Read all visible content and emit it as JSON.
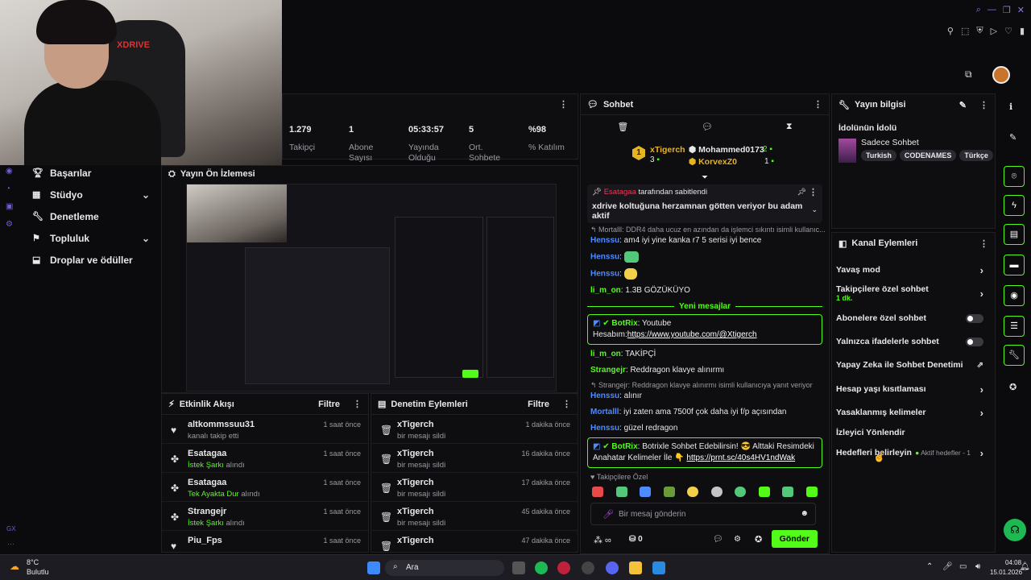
{
  "stats": [
    {
      "value": "1.279",
      "label": "Takipçi"
    },
    {
      "value": "1",
      "label": "Abone Sayısı"
    },
    {
      "value": "05:33:57",
      "label": "Yayında Olduğu"
    },
    {
      "value": "5",
      "label": "Ort. Sohbete"
    },
    {
      "value": "%98",
      "label": "% Katılım"
    }
  ],
  "cam": {
    "logo": "XDRIVE"
  },
  "nav": [
    {
      "label": "Başarılar",
      "icon": "trophy-icon"
    },
    {
      "label": "Stüdyo",
      "icon": "studio-icon",
      "chevron": "⌄"
    },
    {
      "label": "Denetleme",
      "icon": "wrench-icon"
    },
    {
      "label": "Topluluk",
      "icon": "community-icon",
      "chevron": "⌄"
    },
    {
      "label": "Droplar ve ödüller",
      "icon": "drops-icon"
    }
  ],
  "nav_badge": "GX",
  "preview": {
    "title": "Yayın Ön İzlemesi"
  },
  "activity": {
    "title": "Etkinlik Akışı",
    "filter": "Filtre",
    "items": [
      {
        "name": "altkommssuu31",
        "sub": "kanalı takip etti",
        "time": "1 saat önce",
        "icon": "heart-icon"
      },
      {
        "name": "Esatagaa",
        "sub_green": "İstek Şarkı",
        "sub": " alındı",
        "time": "1 saat önce",
        "icon": "reward-icon"
      },
      {
        "name": "Esatagaa",
        "sub_green": "Tek Ayakta Dur",
        "sub": " alındı",
        "time": "1 saat önce",
        "icon": "reward-icon"
      },
      {
        "name": "Strangejr",
        "sub_green": "İstek Şarkı",
        "sub": " alındı",
        "time": "1 saat önce",
        "icon": "reward-icon"
      },
      {
        "name": "Piu_Fps",
        "sub": "",
        "time": "1 saat önce",
        "icon": "heart-icon"
      }
    ]
  },
  "moderation": {
    "title": "Denetim Eylemleri",
    "filter": "Filtre",
    "items": [
      {
        "name": "xTigerch",
        "sub": "bir mesajı sildi",
        "time": "1 dakika önce"
      },
      {
        "name": "xTigerch",
        "sub": "bir mesajı sildi",
        "time": "16 dakika önce"
      },
      {
        "name": "xTigerch",
        "sub": "bir mesajı sildi",
        "time": "17 dakika önce"
      },
      {
        "name": "xTigerch",
        "sub": "bir mesajı sildi",
        "time": "45 dakika önce"
      },
      {
        "name": "xTigerch",
        "sub": "",
        "time": "47 dakika önce"
      }
    ]
  },
  "chat": {
    "title": "Sohbet",
    "leaderboard": [
      {
        "name": "xTigerch",
        "count": "3",
        "rank": "1"
      },
      {
        "name": "Mohammed0173",
        "count": "2"
      },
      {
        "name": "KorvexZ0",
        "count": "1"
      }
    ],
    "pinned": {
      "by": "Esatagaa",
      "by_suffix": "tarafından sabitlendi",
      "text": "xdrive koltuğuna herzamnan götten veriyor bu adam aktif"
    },
    "reply_top": "Mortalll: DDR4 daha ucuz en azından da işlemci sıkıntı isimli kullanıc...",
    "messages1": [
      {
        "user": "Henssu",
        "color": "#4e8bff",
        "text": ": am4 iyi yine kanka r7 5 serisi iyi bence"
      },
      {
        "user": "Henssu",
        "color": "#4e8bff",
        "text": ":"
      },
      {
        "user": "Henssu",
        "color": "#4e8bff",
        "text": ":"
      },
      {
        "user": "li_m_on",
        "color": "#53fc18",
        "text": ": 1.3B GÖZÜKÜYO"
      }
    ],
    "new_messages": "Yeni mesajlar",
    "bot1": {
      "user": "BotRix",
      "text": ": Youtube Hesabım:",
      "link": "https://www.youtube.com/@Xtigerch"
    },
    "messages2": [
      {
        "user": "li_m_on",
        "color": "#53fc18",
        "text": ": TAKİPÇİ"
      },
      {
        "user": "Strangejr",
        "color": "#53fc18",
        "text": ": Reddragon klavye alınırmı"
      }
    ],
    "reply2": "Strangejr: Reddragon klavye alınırmı isimli kullanıcıya yanıt veriyor",
    "messages3": [
      {
        "user": "Henssu",
        "color": "#4e8bff",
        "text": ": alınır"
      },
      {
        "user": "Mortalll",
        "color": "#4e8bff",
        "text": ": iyi zaten ama 7500f çok daha iyi f/p açısından"
      },
      {
        "user": "Henssu",
        "color": "#4e8bff",
        "text": ": güzel redragon"
      }
    ],
    "bot2": {
      "user": "BotRix",
      "text": ": Botrixle Sohbet Edebilirsin! 😎 Alttaki Resimdeki Anahatar Kelimeler İle 👇",
      "link": "https://prnt.sc/40s4HV1ndWak"
    },
    "emote_label": "Takipçilere Özel",
    "input_placeholder": "Bir mesaj gönderin",
    "points": "0",
    "send": "Gönder"
  },
  "info": {
    "title": "Yayın bilgisi",
    "stream_title": "İdolünün İdolü",
    "category": "Sadece Sohbet",
    "tags": [
      "Turkish",
      "CODENAMES",
      "Türkçe"
    ]
  },
  "actions": {
    "title": "Kanal Eylemleri",
    "items": [
      {
        "label": "Yavaş mod",
        "type": "chevron"
      },
      {
        "label": "Takipçilere özel sohbet",
        "sub": "1 dk.",
        "type": "chevron"
      },
      {
        "label": "Abonelere özel sohbet",
        "type": "toggle"
      },
      {
        "label": "Yalnızca ifadelerle sohbet",
        "type": "toggle"
      },
      {
        "label": "Yapay Zeka ile Sohbet Denetimi",
        "type": "external"
      },
      {
        "label": "Hesap yaşı kısıtlaması",
        "type": "chevron"
      },
      {
        "label": "Yasaklanmış kelimeler",
        "type": "chevron"
      },
      {
        "label": "İzleyici Yönlendir",
        "type": "none"
      },
      {
        "label": "Hedefleri belirleyin",
        "type": "chevron",
        "status": "Aktif hedefler - 1"
      }
    ]
  },
  "taskbar": {
    "weather_temp": "8°C",
    "weather_desc": "Bulutlu",
    "search": "Ara",
    "time": "04:08",
    "date": "15.01.2026"
  },
  "colors": {
    "accent": "#53fc18",
    "bg": "#0b0b0e",
    "panel": "#0e0e11",
    "purple": "#8a7ee0"
  }
}
